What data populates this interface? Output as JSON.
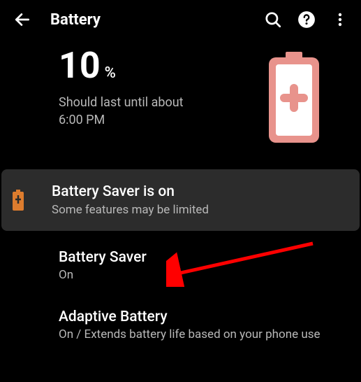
{
  "header": {
    "title": "Battery"
  },
  "battery": {
    "percent_value": "10",
    "percent_symbol": "%",
    "estimate_line1": "Should last until about",
    "estimate_line2": "6:00 PM"
  },
  "notice": {
    "title": "Battery Saver is on",
    "subtitle": "Some features may be limited"
  },
  "settings": {
    "saver": {
      "title": "Battery Saver",
      "subtitle": "On"
    },
    "adaptive": {
      "title": "Adaptive Battery",
      "subtitle": "On / Extends battery life based on your phone use"
    }
  },
  "colors": {
    "accent_orange": "#dd7c2e",
    "battery_pink": "#e8938c"
  }
}
